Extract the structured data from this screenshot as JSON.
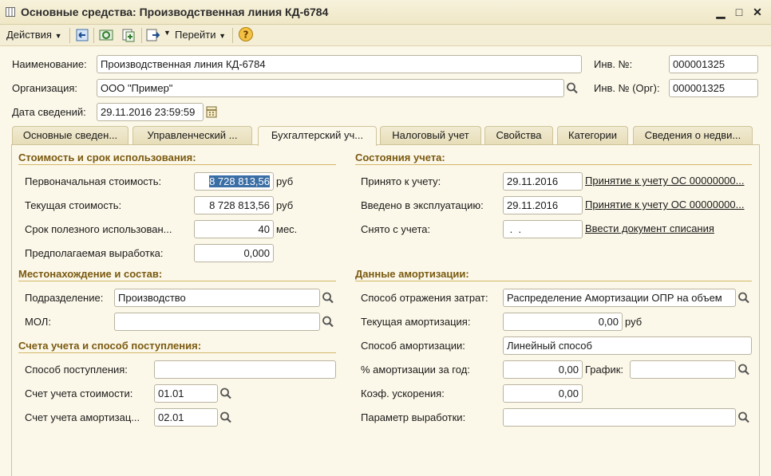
{
  "window": {
    "title": "Основные средства: Производственная линия КД-6784"
  },
  "toolbar": {
    "actions_label": "Действия",
    "goto_label": "Перейти"
  },
  "header": {
    "name_label": "Наименование:",
    "name_value": "Производственная линия КД-6784",
    "org_label": "Организация:",
    "org_value": "ООО \"Пример\"",
    "date_label": "Дата сведений:",
    "date_value": "29.11.2016 23:59:59",
    "inv_label": "Инв. №:",
    "inv_value": "000001325",
    "inv_org_label": "Инв. № (Орг):",
    "inv_org_value": "000001325"
  },
  "tabs": [
    {
      "label": "Основные сведен..."
    },
    {
      "label": "Управленческий ..."
    },
    {
      "label": "Бухгалтерский уч..."
    },
    {
      "label": "Налоговый учет"
    },
    {
      "label": "Свойства"
    },
    {
      "label": "Категории"
    },
    {
      "label": "Сведения о недви..."
    }
  ],
  "cost": {
    "title": "Стоимость и срок использования:",
    "initial_label": "Первоначальная стоимость:",
    "initial_value": "8 728 813,56",
    "current_label": "Текущая стоимость:",
    "current_value": "8 728 813,56",
    "life_label": "Срок полезного использован...",
    "life_value": "40",
    "output_label": "Предполагаемая выработка:",
    "output_value": "0,000",
    "rub": "руб",
    "months": "мес."
  },
  "location": {
    "title": "Местонахождение и состав:",
    "dept_label": "Подразделение:",
    "dept_value": "Производство",
    "mol_label": "МОЛ:",
    "mol_value": ""
  },
  "accounts": {
    "title": "Счета учета и способ поступления:",
    "receipt_label": "Способ поступления:",
    "receipt_value": "",
    "cost_acc_label": "Счет учета стоимости:",
    "cost_acc_value": "01.01",
    "amort_acc_label": "Счет учета амортизац...",
    "amort_acc_value": "02.01"
  },
  "status": {
    "title": "Состояния учета:",
    "accepted_label": "Принято к учету:",
    "accepted_date": "29.11.2016",
    "accepted_link": "Принятие к учету ОС 00000000...",
    "commissioned_label": "Введено в эксплуатацию:",
    "commissioned_date": "29.11.2016",
    "commissioned_link": "Принятие к учету ОС 00000000...",
    "removed_label": "Снято с учета:",
    "removed_date": " .  .",
    "removed_link": "Ввести документ списания"
  },
  "amortization": {
    "title": "Данные амортизации:",
    "expense_label": "Способ отражения затрат:",
    "expense_value": "Распределение Амортизации ОПР на объем",
    "current_label": "Текущая амортизация:",
    "current_value": "0,00",
    "rub": "руб",
    "method_label": "Способ амортизации:",
    "method_value": "Линейный способ",
    "rate_label": "% амортизации за год:",
    "rate_value": "0,00",
    "schedule_label": "График:",
    "schedule_value": "",
    "accel_label": "Коэф. ускорения:",
    "accel_value": "0,00",
    "param_label": "Параметр выработки:",
    "param_value": ""
  }
}
